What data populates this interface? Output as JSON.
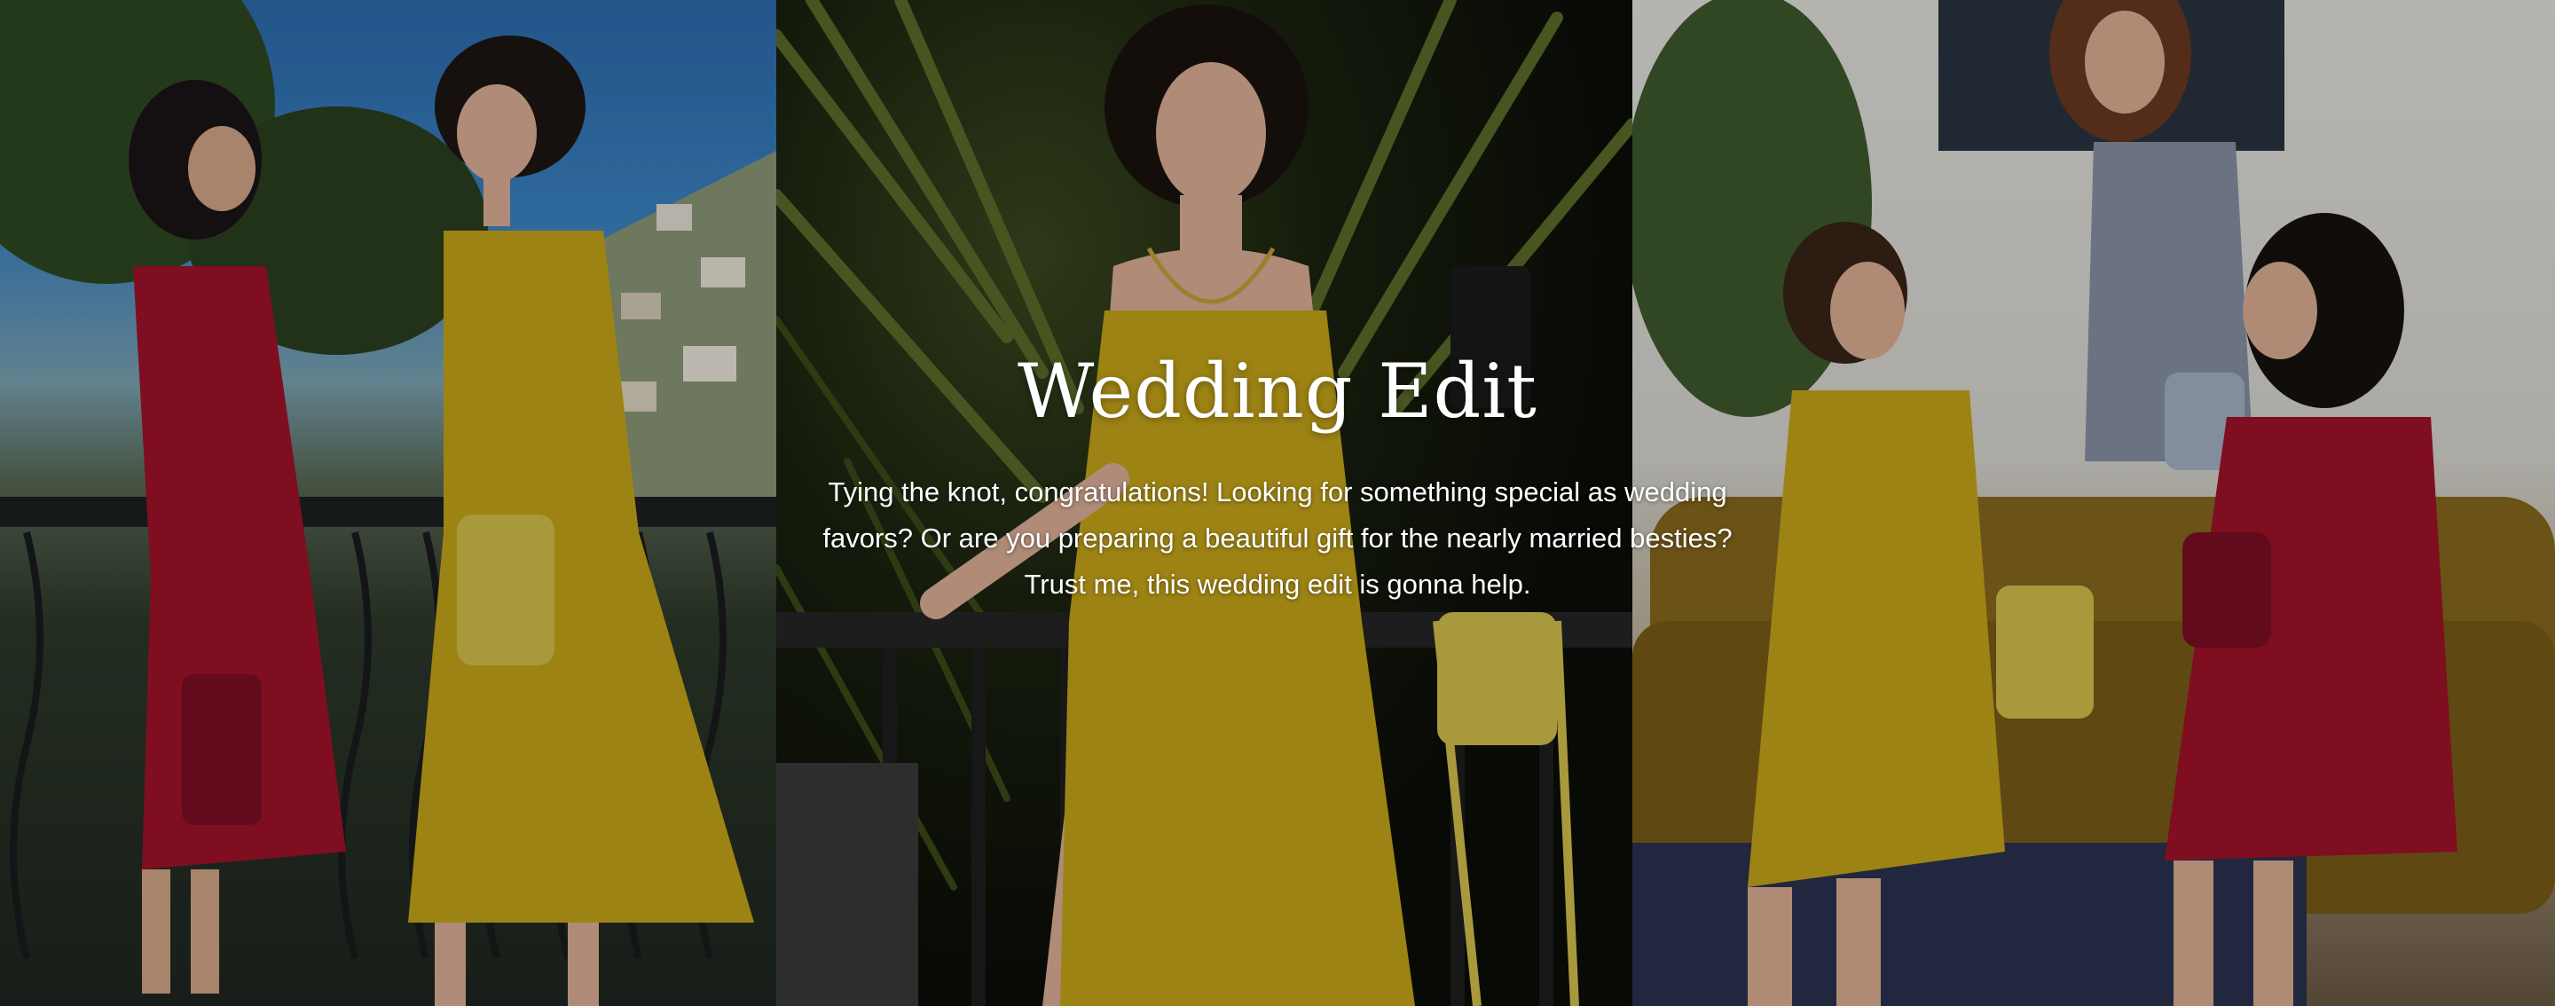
{
  "hero": {
    "title": "Wedding Edit",
    "lines": [
      "Tying the knot, congratulations! Looking for something special as wedding",
      "favors? Or are you preparing a beautiful gift for the nearly married besties?",
      "Trust me, this wedding edit is gonna help."
    ]
  },
  "colors": {
    "gold_dress": "#c9a81a",
    "red_dress": "#a3122b",
    "grey_dress": "#8a94a8"
  },
  "photos": [
    {
      "name": "photo-balcony-two-models"
    },
    {
      "name": "photo-palm-model-yellow-dress"
    },
    {
      "name": "photo-sofa-three-models"
    }
  ]
}
